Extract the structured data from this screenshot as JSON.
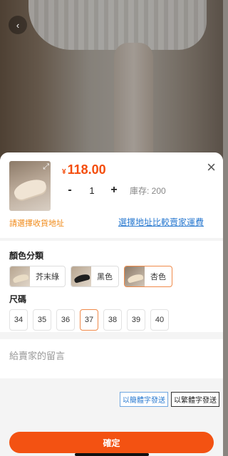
{
  "product": {
    "currency": "¥",
    "price": "118.00",
    "quantity": "1",
    "stock_label": "庫存: 200"
  },
  "stepper": {
    "minus": "-",
    "plus": "+"
  },
  "address": {
    "prompt": "請選擇收貨地址",
    "compare_link": "選擇地址比較賣家運費"
  },
  "options": {
    "color_title": "顏色分類",
    "colors": [
      {
        "label": "芥末綠",
        "shoe_color": "#e9dcc5",
        "selected": false
      },
      {
        "label": "黑色",
        "shoe_color": "#1e1e1e",
        "selected": false
      },
      {
        "label": "杏色",
        "shoe_color": "#efe0c8",
        "selected": true
      }
    ],
    "size_title": "尺碼",
    "sizes": [
      "34",
      "35",
      "36",
      "37",
      "38",
      "39",
      "40"
    ],
    "selected_size": "37"
  },
  "message": {
    "placeholder": "給賣家的留言"
  },
  "font_buttons": {
    "simplified": "以簡體字發送",
    "traditional": "以繁體字發送"
  },
  "confirm_label": "確定",
  "colors": {
    "accent": "#f35212",
    "price": "#f44d0c",
    "link": "#2a7ad0",
    "warn": "#f08a18"
  }
}
